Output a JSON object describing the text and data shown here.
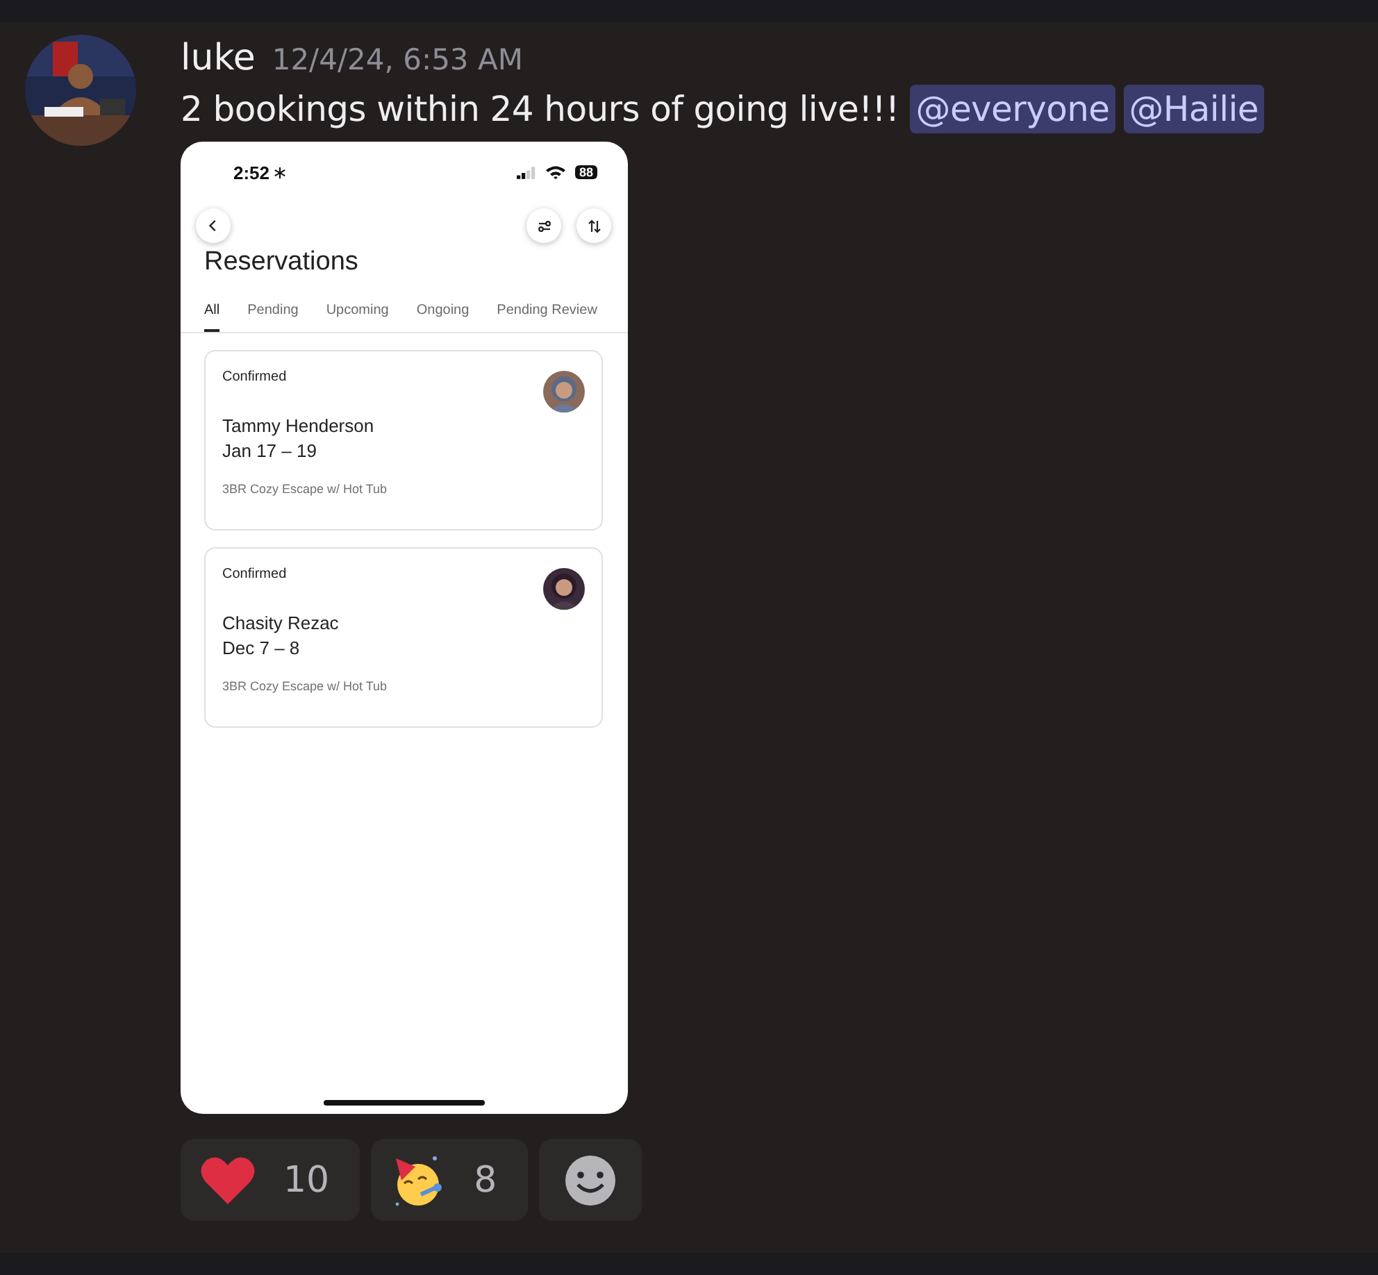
{
  "message": {
    "author": "luke",
    "timestamp": "12/4/24, 6:53 AM",
    "text": "2 bookings within 24 hours of going live!!!",
    "mentions": [
      "@everyone",
      "@Hailie"
    ]
  },
  "attachment": {
    "status_bar": {
      "time": "2:52",
      "battery": "88"
    },
    "title": "Reservations",
    "tabs": [
      {
        "label": "All",
        "selected": true
      },
      {
        "label": "Pending",
        "selected": false
      },
      {
        "label": "Upcoming",
        "selected": false
      },
      {
        "label": "Ongoing",
        "selected": false
      },
      {
        "label": "Pending Review",
        "selected": false
      }
    ],
    "reservations": [
      {
        "status": "Confirmed",
        "guest": "Tammy Henderson",
        "dates": "Jan 17 – 19",
        "listing": "3BR Cozy Escape w/ Hot Tub"
      },
      {
        "status": "Confirmed",
        "guest": "Chasity Rezac",
        "dates": "Dec 7 – 8",
        "listing": "3BR Cozy Escape w/ Hot Tub"
      }
    ]
  },
  "reactions": [
    {
      "kind": "heart",
      "count": "10"
    },
    {
      "kind": "party",
      "count": "8"
    },
    {
      "kind": "add"
    }
  ]
}
